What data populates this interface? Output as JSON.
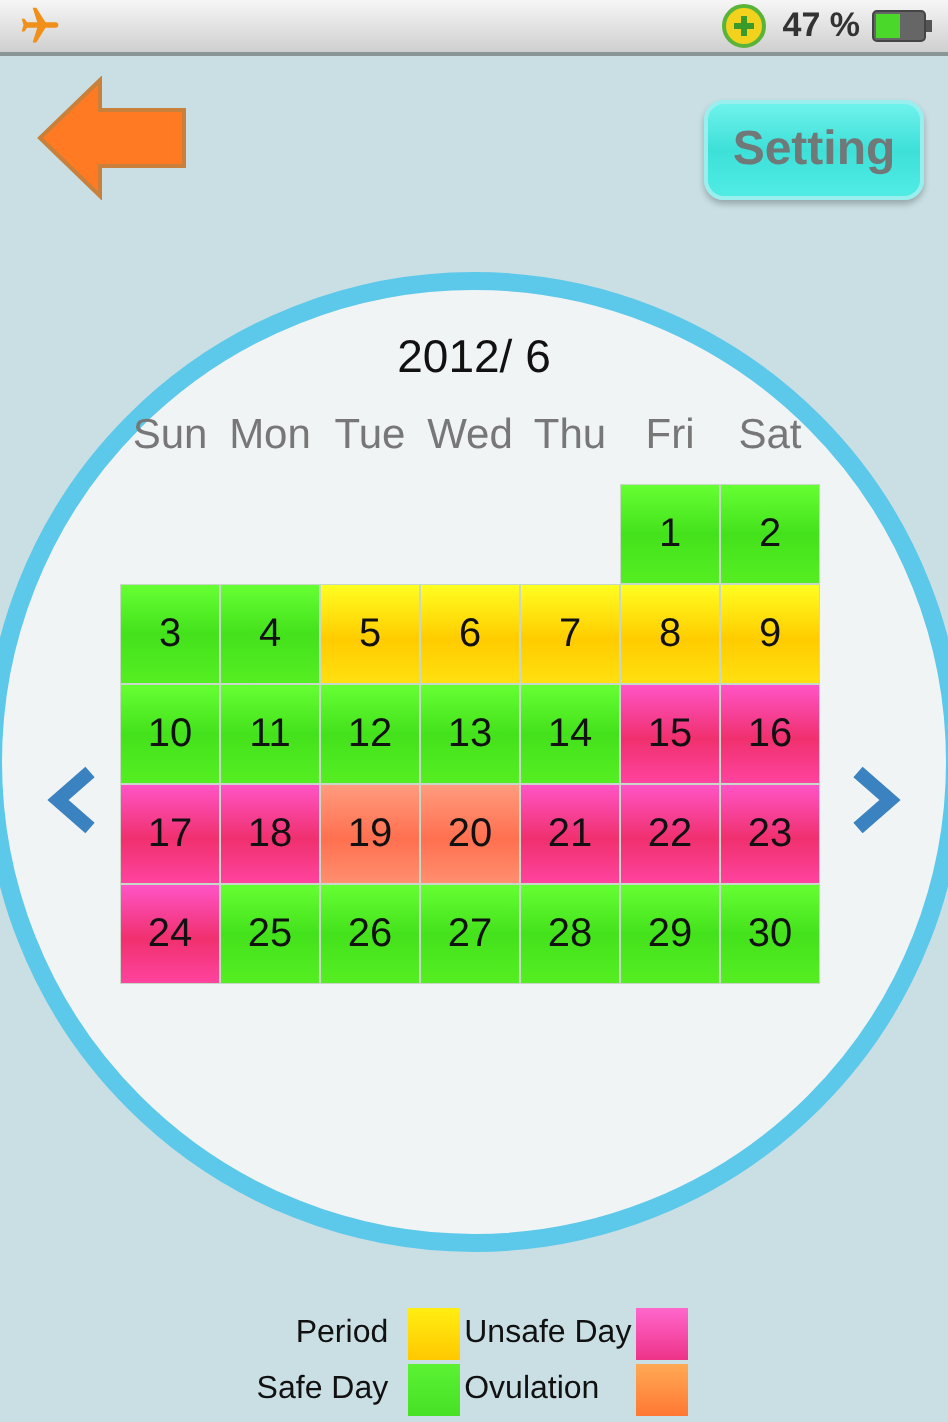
{
  "status_bar": {
    "battery_text": "47 %"
  },
  "header": {
    "setting_button": "Setting"
  },
  "calendar": {
    "title": "2012/ 6",
    "weekdays": [
      "Sun",
      "Mon",
      "Tue",
      "Wed",
      "Thu",
      "Fri",
      "Sat"
    ],
    "weeks": [
      {
        "days": [
          {
            "label": "1",
            "kind": "safe"
          },
          {
            "label": "2",
            "kind": "safe"
          }
        ]
      },
      {
        "days": [
          {
            "label": "3",
            "kind": "safe"
          },
          {
            "label": "4",
            "kind": "safe"
          },
          {
            "label": "5",
            "kind": "period"
          },
          {
            "label": "6",
            "kind": "period"
          },
          {
            "label": "7",
            "kind": "period"
          },
          {
            "label": "8",
            "kind": "period"
          },
          {
            "label": "9",
            "kind": "period"
          }
        ]
      },
      {
        "days": [
          {
            "label": "10",
            "kind": "safe"
          },
          {
            "label": "11",
            "kind": "safe"
          },
          {
            "label": "12",
            "kind": "safe"
          },
          {
            "label": "13",
            "kind": "safe"
          },
          {
            "label": "14",
            "kind": "safe"
          },
          {
            "label": "15",
            "kind": "unsafe"
          },
          {
            "label": "16",
            "kind": "unsafe"
          }
        ]
      },
      {
        "days": [
          {
            "label": "17",
            "kind": "unsafe"
          },
          {
            "label": "18",
            "kind": "unsafe"
          },
          {
            "label": "19",
            "kind": "ovulation"
          },
          {
            "label": "20",
            "kind": "ovulation"
          },
          {
            "label": "21",
            "kind": "unsafe"
          },
          {
            "label": "22",
            "kind": "unsafe"
          },
          {
            "label": "23",
            "kind": "unsafe"
          }
        ]
      },
      {
        "days": [
          {
            "label": "24",
            "kind": "unsafe"
          },
          {
            "label": "25",
            "kind": "safe"
          },
          {
            "label": "26",
            "kind": "safe"
          },
          {
            "label": "27",
            "kind": "safe"
          },
          {
            "label": "28",
            "kind": "safe"
          },
          {
            "label": "29",
            "kind": "safe"
          },
          {
            "label": "30",
            "kind": "safe"
          }
        ]
      }
    ]
  },
  "legend": [
    {
      "label": "Period",
      "kind": "period"
    },
    {
      "label": "Unsafe Day",
      "kind": "unsafe"
    },
    {
      "label": "Safe Day",
      "kind": "safe"
    },
    {
      "label": "Ovulation",
      "kind": "ovulation"
    }
  ]
}
